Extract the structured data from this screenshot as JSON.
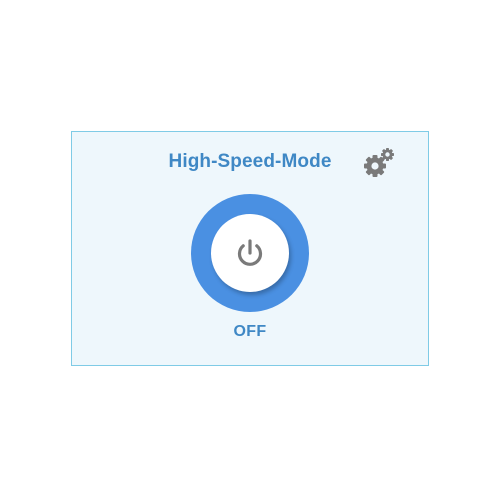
{
  "panel": {
    "title": "High-Speed-Mode",
    "status": "OFF",
    "state": "off"
  },
  "icons": {
    "settings": "gears-icon",
    "power": "power-icon"
  },
  "colors": {
    "accent": "#4a90e2",
    "title_text": "#3f88c5",
    "card_background": "#eef7fc",
    "card_border": "#7fcbe6",
    "icon_gray": "#7a7a7a"
  }
}
